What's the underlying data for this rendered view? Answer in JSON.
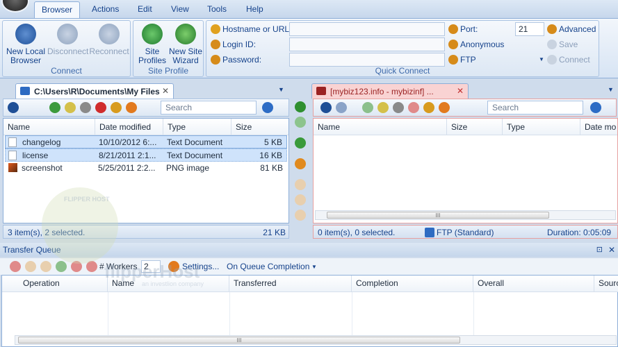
{
  "menu": {
    "items": [
      "Browser",
      "Actions",
      "Edit",
      "View",
      "Tools",
      "Help"
    ]
  },
  "ribbon": {
    "connect": {
      "label": "Connect",
      "buttons": [
        {
          "label": "New Local Browser",
          "lines": [
            "New Local",
            "Browser"
          ]
        },
        {
          "label": "Disconnect",
          "lines": [
            "Disconnect"
          ]
        },
        {
          "label": "Reconnect",
          "lines": [
            "Reconnect"
          ]
        }
      ]
    },
    "site_profile": {
      "label": "Site Profile",
      "buttons": [
        {
          "lines": [
            "Site",
            "Profiles"
          ]
        },
        {
          "lines": [
            "New Site",
            "Wizard"
          ]
        }
      ]
    },
    "quick_connect": {
      "label": "Quick Connect",
      "hostname_label": "Hostname or URL:",
      "login_label": "Login ID:",
      "password_label": "Password:",
      "port_label": "Port:",
      "port_value": "21",
      "anonymous_label": "Anonymous",
      "protocol_label": "FTP",
      "advanced_label": "Advanced",
      "save_label": "Save",
      "connect_label": "Connect"
    }
  },
  "left_pane": {
    "tab_label": "C:\\Users\\R\\Documents\\My Files",
    "search_placeholder": "Search",
    "columns": [
      "Name",
      "Date modified",
      "Type",
      "Size"
    ],
    "rows": [
      {
        "name": "changelog",
        "date": "10/10/2012 6:...",
        "type": "Text Document",
        "size": "5 KB",
        "selected": true
      },
      {
        "name": "license",
        "date": "8/21/2011 2:1...",
        "type": "Text Document",
        "size": "16 KB",
        "selected": true
      },
      {
        "name": "screenshot",
        "date": "5/25/2011 2:2...",
        "type": "PNG image",
        "size": "81 KB",
        "selected": false
      }
    ],
    "status_left": "3 item(s), 2 selected.",
    "status_right": "21 KB"
  },
  "right_pane": {
    "tab_label": "[mybiz123.info - mybizinf] ...",
    "search_placeholder": "Search",
    "columns": [
      "Name",
      "Size",
      "Type",
      "Date mo"
    ],
    "status_left": "0 item(s), 0 selected.",
    "status_mid": "FTP (Standard)",
    "status_right": "Duration: 0:05:09",
    "scroll_grip": "III"
  },
  "queue": {
    "title": "Transfer Queue",
    "workers_label": "# Workers",
    "workers_value": "2",
    "settings_label": "Settings...",
    "completion_label": "On Queue Completion",
    "columns": [
      "Operation",
      "Name",
      "Transferred",
      "Completion",
      "Overall",
      "Sourc"
    ],
    "scroll_grip": "III"
  },
  "watermark": {
    "brand": "flipperHost",
    "tagline": "an investlion company",
    "badge": "FLIPPER HOST"
  },
  "colors": {
    "accent": "#15428b",
    "ribbon_bg": "#dce7f4",
    "selected_row": "#cfe3fb",
    "remote_tab": "#f9d3d3"
  }
}
